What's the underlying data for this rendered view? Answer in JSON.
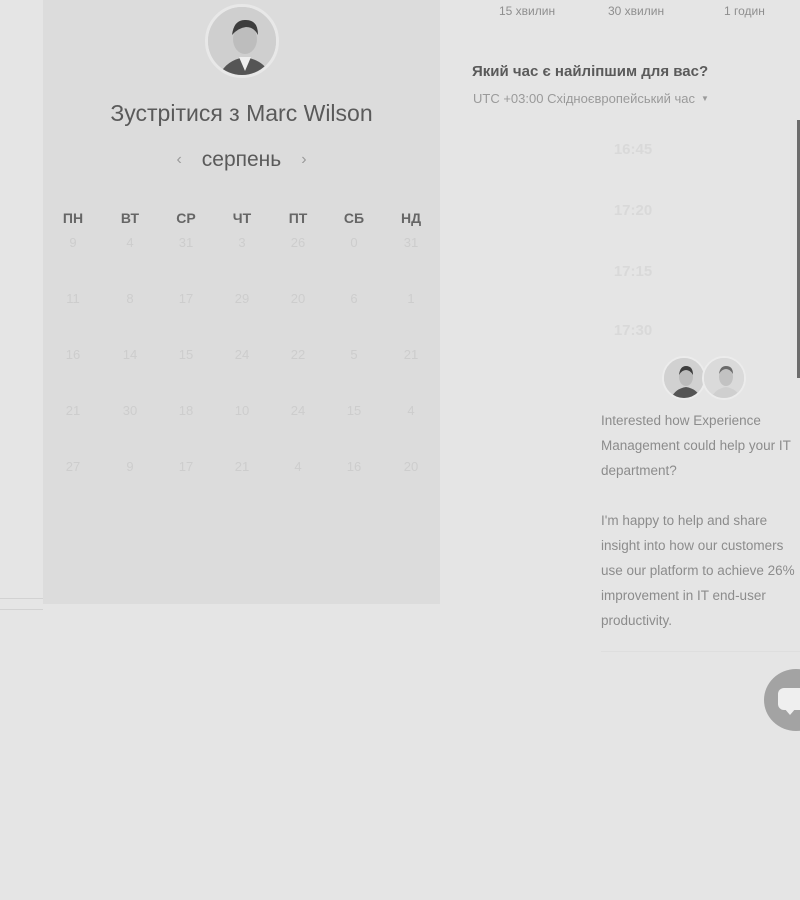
{
  "durations": [
    "15 хвилин",
    "30 хвилин",
    "1 годин"
  ],
  "title": "Зустрітися з Marc Wilson",
  "calendar": {
    "month": "серпень",
    "prev_icon": "chevron-left-icon",
    "next_icon": "chevron-right-icon",
    "weekdays": [
      "ПН",
      "ВТ",
      "СР",
      "ЧТ",
      "ПТ",
      "СБ",
      "НД"
    ],
    "weeks": [
      [
        "9",
        "4",
        "31",
        "3",
        "26",
        "0",
        "31"
      ],
      [
        "11",
        "8",
        "17",
        "29",
        "20",
        "6",
        "1"
      ],
      [
        "16",
        "14",
        "15",
        "24",
        "22",
        "5",
        "21"
      ],
      [
        "21",
        "30",
        "18",
        "10",
        "24",
        "15",
        "4"
      ],
      [
        "27",
        "9",
        "17",
        "21",
        "4",
        "16",
        "20"
      ]
    ]
  },
  "booking": {
    "question": "Який час є найліпшим для вас?",
    "timezone": "UTC +03:00 Східноєвропейський час",
    "timezone_icon": "caret-down-icon",
    "slots": [
      "16:45",
      "17:20",
      "17:15",
      "17:30"
    ]
  },
  "message": {
    "paragraph1": "Interested how Experience Management could help your IT department?",
    "paragraph2": "I'm happy to help and share insight into how our customers use our platform to achieve 26% improvement in IT end-user productivity."
  },
  "chat_icon": "chat-bubble-icon",
  "colors": {
    "background": "#e5e5e5",
    "panel": "#dcdcdc",
    "chat_button": "#a3a3a3"
  }
}
